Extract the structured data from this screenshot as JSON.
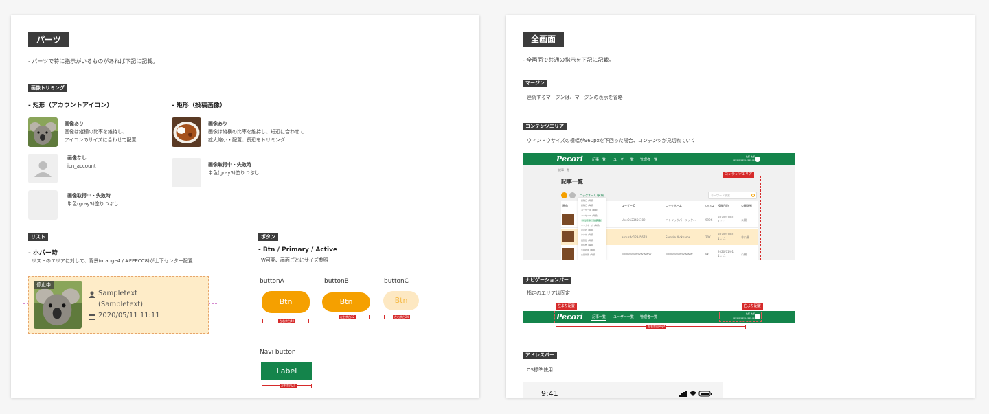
{
  "left": {
    "title": "パーツ",
    "intro": "- パーツで特に指示がいるものがあれば下記に記載。",
    "image_trim": {
      "tag": "画像トリミング",
      "col1": {
        "heading": "- 矩形（アカウントアイコン）",
        "items": [
          {
            "title": "画像あり",
            "line1": "画像は縦横の比率を維持し、",
            "line2": "アイコンのサイズに合わせて配置"
          },
          {
            "title": "画像なし",
            "line1": "icn_account"
          },
          {
            "title": "画像取得中・失敗時",
            "line1": "単色(gray5)塗りつぶし"
          }
        ]
      },
      "col2": {
        "heading": "- 矩形（投稿画像）",
        "items": [
          {
            "title": "画像あり",
            "line1": "画像は縦横の比率を維持し、短辺に合わせて",
            "line2": "拡大縮小・配置、長辺をトリミング"
          },
          {
            "title": "画像取得中・失敗時",
            "line1": "単色(gray5)塗りつぶし"
          }
        ]
      }
    },
    "list": {
      "tag": "リスト",
      "heading": "- ホバー時",
      "desc": "リストのエリアに対して、背景(orange4 / #FEECC8)が上下センター配置",
      "card": {
        "badge": "停止中",
        "name": "Sampletext",
        "sub": "(Sampletext)",
        "date": "2020/05/11 11:11"
      },
      "colors": {
        "hover_bg": "#FEECC8",
        "hover_border": "#E7A66B"
      }
    },
    "button": {
      "tag": "ボタン",
      "heading": "- Btn / Primary / Active",
      "desc": "W可変、画面ごとにサイズ参照",
      "buttons": [
        {
          "name": "buttonA",
          "label": "Btn",
          "measure": "左右余白40"
        },
        {
          "name": "buttonB",
          "label": "Btn",
          "measure": "左右余白32"
        },
        {
          "name": "buttonC",
          "label": "Btn",
          "measure": "左右余白24"
        }
      ],
      "navi": {
        "name": "Navi button",
        "label": "Label",
        "measure": "左右余白24"
      },
      "colors": {
        "primary": "#F5A000",
        "disabled_bg": "#FDE8C2",
        "navi": "#14844B"
      }
    }
  },
  "right": {
    "title": "全画面",
    "intro": "- 全画面で共通の指示を下記に記載。",
    "margin": {
      "tag": "マージン",
      "desc": "連続するマージンは、マージンの表示を省略"
    },
    "content_area": {
      "tag": "コンテンツエリア",
      "desc": "ウィンドウサイズの横幅が960pxを下回った場合、コンテンツが見切れていく",
      "mock": {
        "logo": "Pecori",
        "nav": [
          "記事一覧",
          "ユーザー一覧",
          "管理者一覧"
        ],
        "user_name": "佐藤 太郎",
        "user_mail": "xxxxx@xxxx.xxxx.xx.xx",
        "breadcrumb": "記事一覧",
        "page_title": "記事一覧",
        "area_label": "コンテンツエリア",
        "search_placeholder": "キーワード検索",
        "filter_label": "ニックネーム (昇順)",
        "sort_options": [
          "投稿日 (昇順)",
          "投稿日 (降順)",
          "ユーザーID (昇順)",
          "ユーザーID (降順)",
          "ニックネーム (昇順)",
          "ニックネーム (降順)",
          "いいね (昇順)",
          "いいね (降順)",
          "閲覧数 (昇順)",
          "閲覧数 (降順)",
          "公開状態 (昇順)",
          "公開状態 (降順)"
        ],
        "columns": [
          "画像",
          "ユーザーID",
          "ニックネーム",
          "いいね",
          "投稿日時",
          "公開状態"
        ],
        "rows": [
          {
            "user_id": "User0123456789",
            "nickname": "パトリックパトリック...",
            "likes": "999K",
            "date": "2020/01/01",
            "time": "11:11",
            "status": "公開"
          },
          {
            "user_id": "anzusdo12345678",
            "nickname": "Sample Nickname",
            "likes": "20K",
            "date": "2020/01/01",
            "time": "11:11",
            "status": "非公開"
          },
          {
            "user_id": "WWWWWWWWWWW...",
            "nickname": "WWWWWWWWWW...",
            "likes": "9K",
            "date": "2020/01/01",
            "time": "11:11",
            "status": "公開"
          }
        ],
        "row_prefix": "WW..."
      }
    },
    "navbar": {
      "tag": "ナビゲーションバー",
      "desc": "指定のエリアは固定",
      "left_label": "左より配置",
      "right_label": "右より配置",
      "width_label": "左右余白96pt",
      "logo": "Pecori",
      "nav": [
        "記事一覧",
        "ユーザー一覧",
        "管理者一覧"
      ],
      "user_name": "佐藤 太郎",
      "user_mail": "xxxxx@xxxx.xxxx.xx.xx"
    },
    "address": {
      "tag": "アドレスバー",
      "desc": "OS標準使用",
      "time": "9:41"
    },
    "colors": {
      "brand_green": "#14844B",
      "accent_red": "#D62B2B",
      "row_highlight": "#FEECC8"
    }
  }
}
